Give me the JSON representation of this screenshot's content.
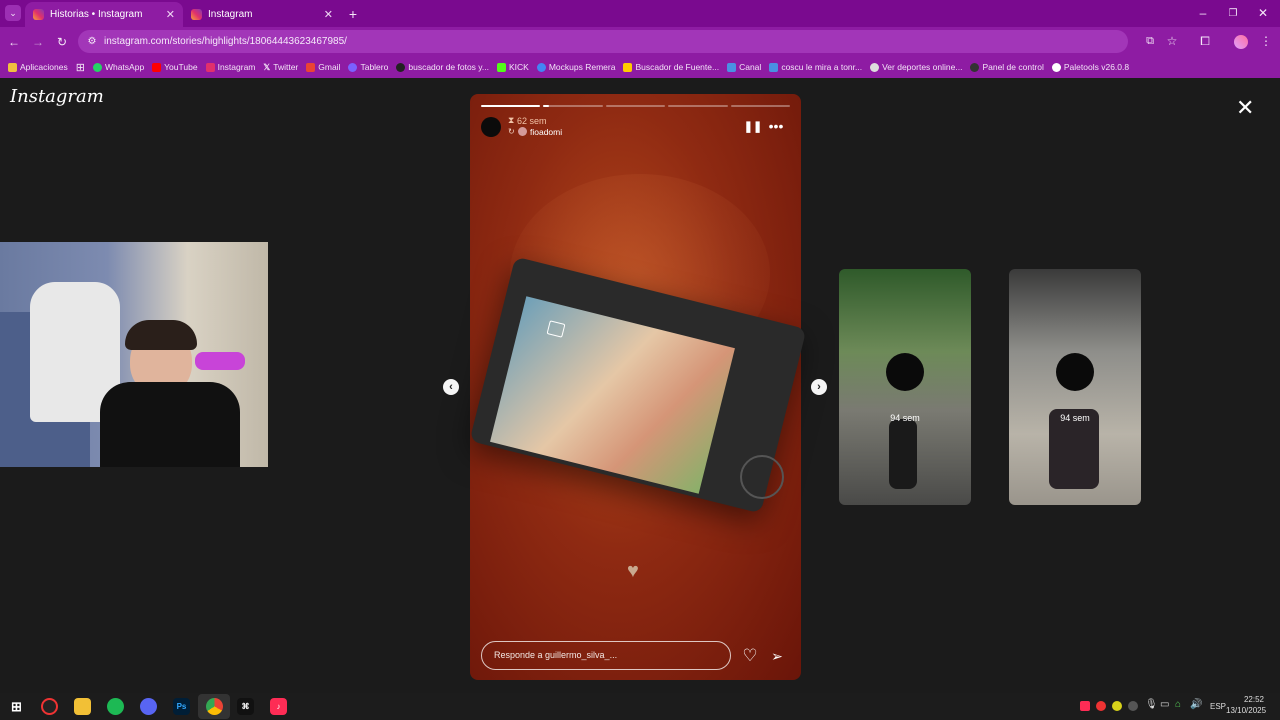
{
  "browser": {
    "tabs": [
      {
        "title": "Historias • Instagram",
        "active": true
      },
      {
        "title": "Instagram",
        "active": false
      }
    ],
    "new_tab_symbol": "+",
    "url": "instagram.com/stories/highlights/18064443623467985/",
    "bookmarks": [
      {
        "label": "Aplicaciones",
        "color": "#f0c040"
      },
      {
        "label": "WhatsApp",
        "color": "#25d366"
      },
      {
        "label": "YouTube",
        "color": "#ff0000"
      },
      {
        "label": "Instagram",
        "color": "#e1306c"
      },
      {
        "label": "Twitter",
        "color": "#000000"
      },
      {
        "label": "Gmail",
        "color": "#ea4335"
      },
      {
        "label": "Tablero",
        "color": "#7b61ff"
      },
      {
        "label": "buscador de fotos y...",
        "color": "#222222"
      },
      {
        "label": "KICK",
        "color": "#53fc18"
      },
      {
        "label": "Mockups Remera",
        "color": "#4285f4"
      },
      {
        "label": "Buscador de Fuente...",
        "color": "#ffcc00"
      },
      {
        "label": "Canal",
        "color": "#4a90e2"
      },
      {
        "label": "coscu le mira a tonr...",
        "color": "#4a90e2"
      },
      {
        "label": "Ver deportes online...",
        "color": "#dddddd"
      },
      {
        "label": "Panel de control",
        "color": "#333333"
      },
      {
        "label": "Paletools v26.0.8",
        "color": "#ffffff"
      }
    ]
  },
  "instagram": {
    "logo": "Instagram",
    "story": {
      "time_ago": "62 sem",
      "username": "fioadomi",
      "reply_placeholder": "Responde a guillermo_silva_...",
      "progress_segments": 5,
      "progress_active_index": 1,
      "progress_active_fraction": 0.1
    },
    "side_stories": [
      {
        "time_ago": "94 sem"
      },
      {
        "time_ago": "94 sem"
      }
    ]
  },
  "taskbar": {
    "language": "ESP",
    "time": "22:52",
    "date": "13/10/2025",
    "apps": [
      "start",
      "overwolf",
      "file-explorer",
      "spotify",
      "discord",
      "photoshop",
      "chrome",
      "capcut",
      "tiktok"
    ]
  },
  "colors": {
    "chrome_tab_bg": "#7a0a8f",
    "chrome_toolbar_bg": "#8e1ca3",
    "page_bg": "#1b1b1b"
  }
}
